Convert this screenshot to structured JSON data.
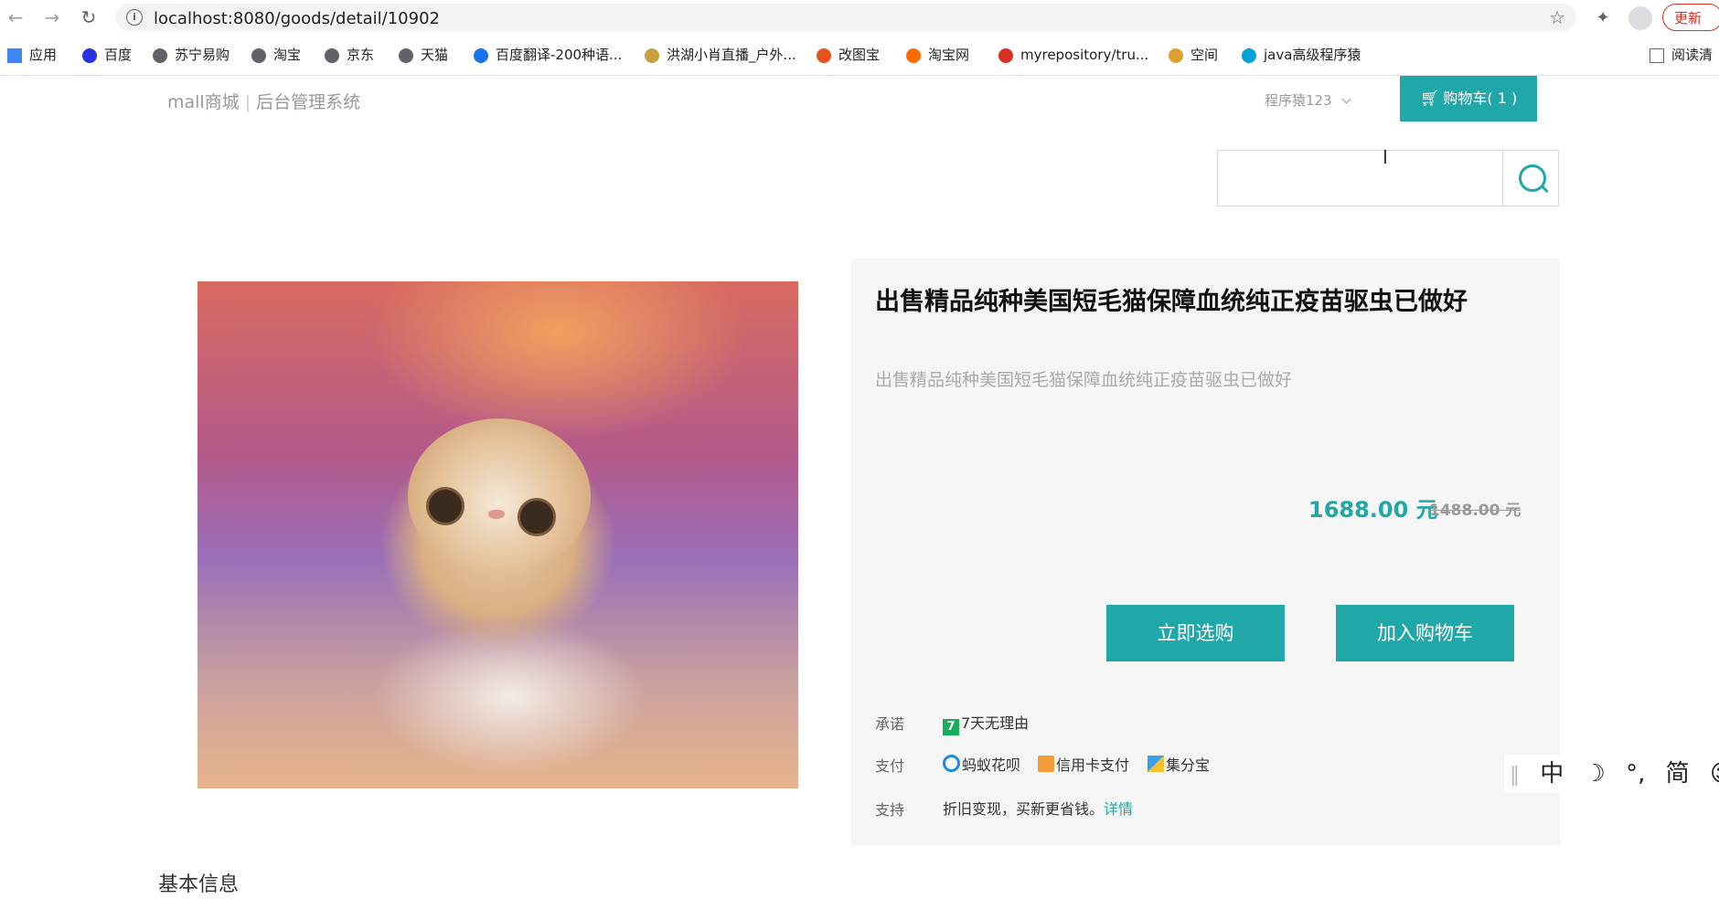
{
  "browser": {
    "url": "localhost:8080/goods/detail/10902",
    "update_label": "更新",
    "reading_label": "阅读清",
    "bookmarks": [
      {
        "label": "应用",
        "color": "#4285f4"
      },
      {
        "label": "百度",
        "color": "#2932e1"
      },
      {
        "label": "苏宁易购",
        "color": "#5f6368"
      },
      {
        "label": "淘宝",
        "color": "#5f6368"
      },
      {
        "label": "京东",
        "color": "#5f6368"
      },
      {
        "label": "天猫",
        "color": "#5f6368"
      },
      {
        "label": "百度翻译-200种语...",
        "color": "#1a73e8"
      },
      {
        "label": "洪湖小肖直播_户外...",
        "color": "#c8a040"
      },
      {
        "label": "改图宝",
        "color": "#e8501e"
      },
      {
        "label": "淘宝网",
        "color": "#ff6a00"
      },
      {
        "label": "myrepository/tru...",
        "color": "#d93025"
      },
      {
        "label": "空间",
        "color": "#e0a030"
      },
      {
        "label": "java高级程序猿",
        "color": "#00a1d6"
      }
    ]
  },
  "header": {
    "brand": "mall商城",
    "separator": "|",
    "admin": "后台管理系统",
    "user": "程序猿123",
    "cart_label": "购物车( 1 )"
  },
  "search": {
    "value": "",
    "placeholder": ""
  },
  "product": {
    "title": "出售精品纯种美国短毛猫保障血统纯正疫苗驱虫已做好",
    "subtitle": "出售精品纯种美国短毛猫保障血统纯正疫苗驱虫已做好",
    "price": "1688.00 元",
    "old_price": "1488.00 元",
    "buy_now": "立即选购",
    "add_cart": "加入购物车",
    "promise_label": "承诺",
    "promise_value": "7天无理由",
    "pay_label": "支付",
    "pay_options": [
      "蚂蚁花呗",
      "信用卡支付",
      "集分宝"
    ],
    "support_label": "支持",
    "support_value": "折旧变现，买新更省钱。",
    "support_link": "详情"
  },
  "section_title": "基本信息",
  "ime": {
    "chars": [
      "中",
      "☽",
      "°,",
      "简",
      "☺"
    ]
  },
  "colors": {
    "accent": "#20a8a8"
  }
}
